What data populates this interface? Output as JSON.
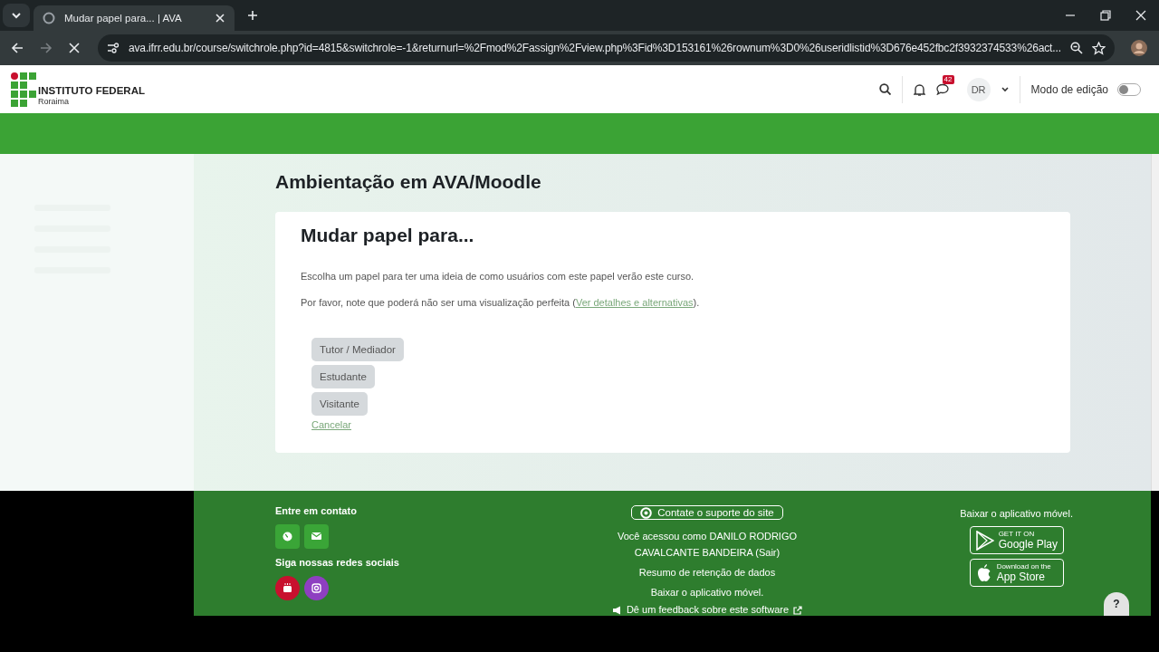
{
  "browser": {
    "tab_title": "Mudar papel para... | AVA",
    "url": "ava.ifrr.edu.br/course/switchrole.php?id=4815&switchrole=-1&returnurl=%2Fmod%2Fassign%2Fview.php%3Fid%3D153161%26rownum%3D0%26useridlistid%3D676e452fbc2f3932374533%26act..."
  },
  "header": {
    "logo_title": "INSTITUTO FEDERAL",
    "logo_subtitle": "Roraima",
    "messages_badge": "42",
    "avatar_initials": "DR",
    "edit_mode": {
      "label": "Modo de edição",
      "on": false
    }
  },
  "page": {
    "course_title": "Ambientação em AVA/Moodle",
    "heading": "Mudar papel para...",
    "intro": "Escolha um papel para ter uma ideia de como usuários com este papel verão este curso.",
    "note": {
      "prefix": "Por favor, note que poderá não ser uma visualização perfeita (",
      "link": "Ver detalhes e alternativas",
      "suffix": ")."
    },
    "roles": [
      {
        "label": "Tutor / Mediador"
      },
      {
        "label": "Estudante"
      },
      {
        "label": "Visitante"
      }
    ],
    "cancel": "Cancelar"
  },
  "footer": {
    "contact_title": "Entre em contato",
    "social_title": "Siga nossas redes sociais",
    "support_button": "Contate o suporte do site",
    "logged_in": {
      "prefix": "Você acessou como DANILO RODRIGO CAVALCANTE BANDEIRA (",
      "link": "Sair",
      "suffix": ")"
    },
    "links": [
      "Resumo de retenção de dados",
      "Baixar o aplicativo móvel."
    ],
    "feedback": "Dê um feedback sobre este software",
    "app_title": "Baixar o aplicativo móvel.",
    "stores": [
      {
        "kind": "google",
        "small": "GET IT ON",
        "big": "Google Play"
      },
      {
        "kind": "apple",
        "small": "Download on the",
        "big": "App Store"
      }
    ],
    "help": "?"
  }
}
